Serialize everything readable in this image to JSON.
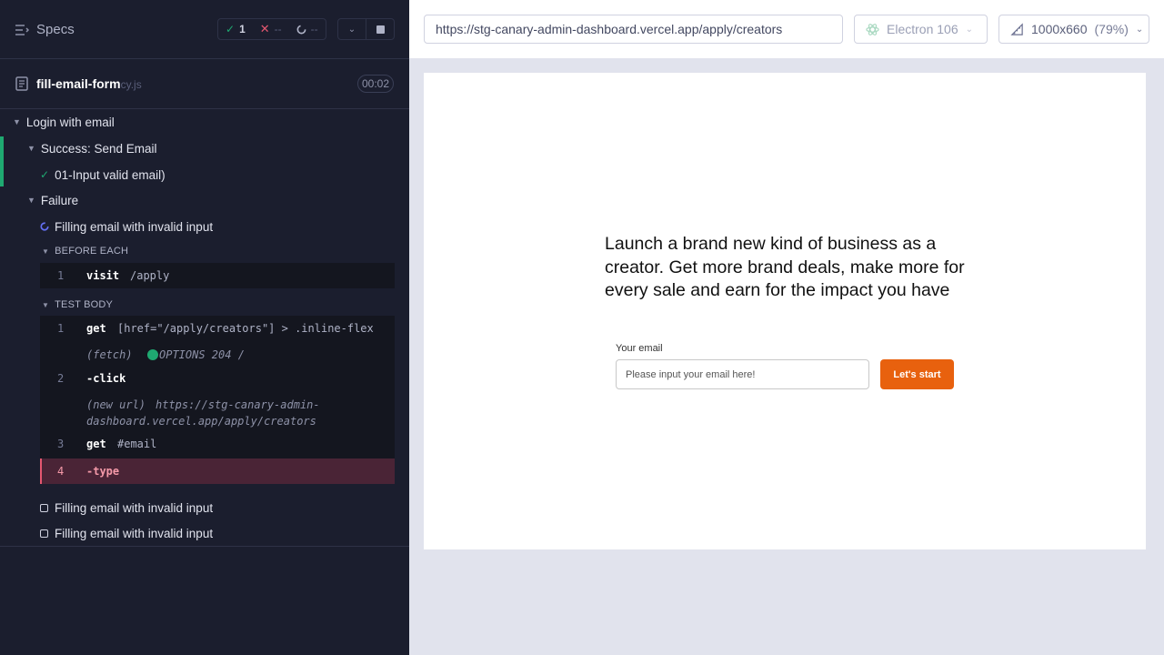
{
  "reporter": {
    "specs_label": "Specs",
    "stats": {
      "passed": "1",
      "failed": "--",
      "pending": "--"
    },
    "file": {
      "name": "fill-email-form",
      "ext": "cy.js",
      "duration": "00:02"
    },
    "tree": {
      "suite_root": "Login with email",
      "suite_success": "Success: Send Email",
      "test_passed": "01-Input valid email)",
      "suite_failure": "Failure",
      "test_running": "Filling email with invalid input",
      "hook_before": "BEFORE EACH",
      "hook_body": "TEST BODY",
      "test_pending_1": "Filling email with invalid input",
      "test_pending_2": "Filling email with invalid input"
    },
    "commands": {
      "before_1_num": "1",
      "before_1_name": "visit",
      "before_1_msg": "/apply",
      "body_1_num": "1",
      "body_1_name": "get",
      "body_1_msg": "[href=\"/apply/creators\"] > .inline-flex",
      "fetch_label": "(fetch)",
      "fetch_msg": "OPTIONS 204 /",
      "body_2_num": "2",
      "body_2_name": "-click",
      "newurl_label": "(new url)",
      "newurl_line1": "https://stg-canary-admin-",
      "newurl_line2": "dashboard.vercel.app/apply/creators",
      "body_3_num": "3",
      "body_3_name": "get",
      "body_3_msg": "#email",
      "body_4_num": "4",
      "body_4_name": "-type"
    }
  },
  "browser": {
    "url": "https://stg-canary-admin-dashboard.vercel.app/apply/creators",
    "engine": "Electron 106",
    "viewport": "1000x660",
    "scale": "(79%)"
  },
  "aut": {
    "hero": "Launch a brand new kind of business as a creator. Get more brand deals, make more for every sale and earn for the impact you have",
    "email_label": "Your email",
    "email_placeholder": "Please input your email here!",
    "button": "Let's start"
  },
  "colors": {
    "accent": "#e8610e",
    "pass": "#1fa971",
    "fail": "#e45770",
    "running": "#6470f3"
  }
}
